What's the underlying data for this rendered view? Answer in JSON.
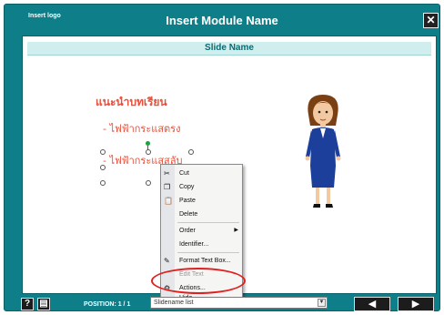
{
  "header": {
    "logo": "Insert logo",
    "title": "Insert Module Name",
    "close": "✕"
  },
  "slide": {
    "name": "Slide Name",
    "heading": "แนะนำบทเรียน",
    "bullets": [
      "- ไฟฟ้ากระแสตรง",
      "- ไฟฟ้ากระแสสลับ"
    ]
  },
  "context_menu": {
    "items": [
      {
        "icon": "scissors-icon",
        "glyph": "✂",
        "label": "Cut"
      },
      {
        "icon": "copy-icon",
        "glyph": "❐",
        "label": "Copy"
      },
      {
        "icon": "paste-icon",
        "glyph": "📋",
        "label": "Paste"
      },
      {
        "icon": "",
        "glyph": "",
        "label": "Delete"
      },
      {
        "icon": "",
        "glyph": "",
        "label": "Order"
      },
      {
        "icon": "",
        "glyph": "",
        "label": "Identifier..."
      },
      {
        "icon": "format-textbox-icon",
        "glyph": "✎",
        "label": "Format Text Box..."
      },
      {
        "icon": "",
        "glyph": "",
        "label": "Edit Text"
      },
      {
        "icon": "actions-icon",
        "glyph": "⚙",
        "label": "Actions..."
      },
      {
        "icon": "",
        "glyph": "",
        "label": "Hide"
      }
    ]
  },
  "footer": {
    "help": "?",
    "notes": "▤",
    "position": "POSITION: 1 / 1",
    "select_value": "Slidename list",
    "prev": "◀",
    "next": "▶"
  },
  "colors": {
    "frame": "#0e7f88",
    "accent_text": "#e8503a",
    "highlight": "#e02020"
  }
}
